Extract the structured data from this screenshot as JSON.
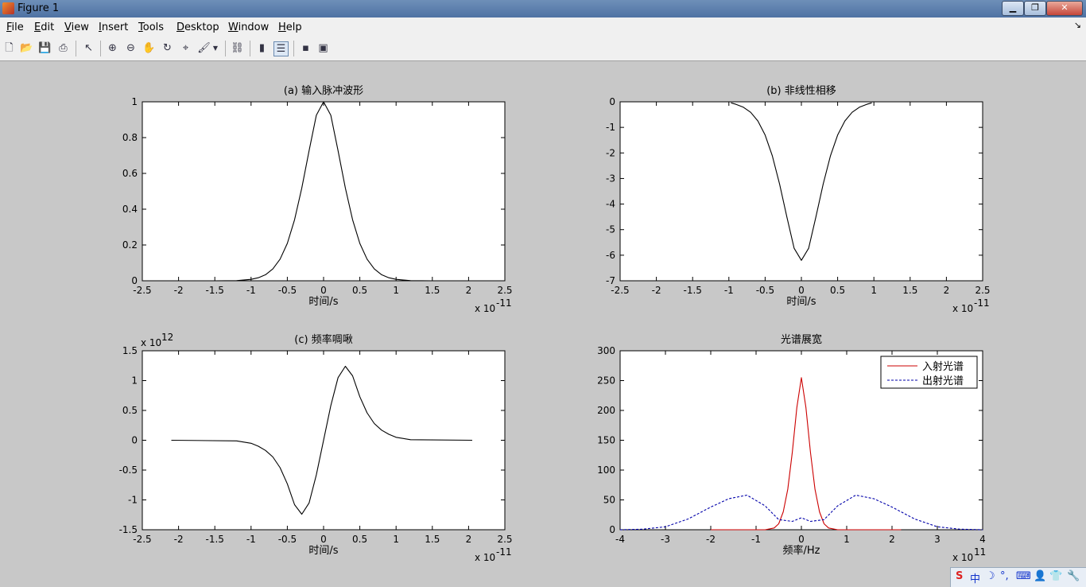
{
  "window": {
    "title": "Figure 1"
  },
  "menu": [
    {
      "label": "File",
      "key": "F",
      "rest": "ile"
    },
    {
      "label": "Edit",
      "key": "E",
      "rest": "dit"
    },
    {
      "label": "View",
      "key": "V",
      "rest": "iew"
    },
    {
      "label": "Insert",
      "key": "I",
      "rest": "nsert"
    },
    {
      "label": "Tools",
      "key": "T",
      "rest": "ools"
    },
    {
      "label": "Desktop",
      "key": "D",
      "rest": "esktop"
    },
    {
      "label": "Window",
      "key": "W",
      "rest": "indow"
    },
    {
      "label": "Help",
      "key": "H",
      "rest": "elp"
    }
  ],
  "toolbar_icons": [
    "new-figure-icon",
    "open-file-icon",
    "save-icon",
    "print-icon",
    "pointer-icon",
    "zoom-in-icon",
    "zoom-out-icon",
    "pan-hand-icon",
    "rotate-3d-icon",
    "data-cursor-icon",
    "brush-icon",
    "brush-dropdown-icon",
    "link-plot-icon",
    "colorbar-icon",
    "legend-icon",
    "hide-plot-tools-icon",
    "show-plot-tools-icon"
  ],
  "tray": {
    "ime_char": "中"
  },
  "colors": {
    "incident": "#cc0000",
    "output": "#0000aa",
    "curve": "#000000"
  },
  "chart_data": [
    {
      "type": "line",
      "title": "(a) 输入脉冲波形",
      "xlabel": "时间/s",
      "ylabel": "",
      "x_exponent": "x 10",
      "x_exponent_power": "-11",
      "xlim": [
        -2.5,
        2.5
      ],
      "ylim": [
        0,
        1
      ],
      "xticks": [
        "-2.5",
        "-2",
        "-1.5",
        "-1",
        "-0.5",
        "0",
        "0.5",
        "1",
        "1.5",
        "2",
        "2.5"
      ],
      "yticks": [
        "0",
        "0.2",
        "0.4",
        "0.6",
        "0.8",
        "1"
      ],
      "series": [
        {
          "color": "#000000",
          "style": "solid",
          "x": [
            -2.1,
            -1.5,
            -1.2,
            -1.0,
            -0.9,
            -0.8,
            -0.7,
            -0.6,
            -0.5,
            -0.4,
            -0.3,
            -0.2,
            -0.1,
            0,
            0.1,
            0.2,
            0.3,
            0.4,
            0.5,
            0.6,
            0.7,
            0.8,
            0.9,
            1.0,
            1.2,
            1.5,
            2.05
          ],
          "y": [
            0,
            0,
            0.001,
            0.008,
            0.017,
            0.034,
            0.066,
            0.121,
            0.209,
            0.341,
            0.518,
            0.727,
            0.925,
            1.0,
            0.925,
            0.727,
            0.518,
            0.341,
            0.209,
            0.121,
            0.066,
            0.034,
            0.017,
            0.008,
            0.001,
            0,
            0
          ]
        }
      ]
    },
    {
      "type": "line",
      "title": "(b) 非线性相移",
      "xlabel": "时间/s",
      "ylabel": "",
      "x_exponent": "x 10",
      "x_exponent_power": "-11",
      "xlim": [
        -2.5,
        2.5
      ],
      "ylim": [
        -7,
        0
      ],
      "xticks": [
        "-2.5",
        "-2",
        "-1.5",
        "-1",
        "-0.5",
        "0",
        "0.5",
        "1",
        "1.5",
        "2",
        "2.5"
      ],
      "yticks": [
        "-7",
        "-6",
        "-5",
        "-4",
        "-3",
        "-2",
        "-1",
        "0"
      ],
      "series": [
        {
          "color": "#000000",
          "style": "solid",
          "x": [
            -0.97,
            -0.9,
            -0.8,
            -0.7,
            -0.6,
            -0.5,
            -0.4,
            -0.3,
            -0.2,
            -0.1,
            0,
            0.1,
            0.2,
            0.3,
            0.4,
            0.5,
            0.6,
            0.7,
            0.8,
            0.9,
            0.97
          ],
          "y": [
            -0.04,
            -0.1,
            -0.21,
            -0.41,
            -0.75,
            -1.3,
            -2.12,
            -3.22,
            -4.51,
            -5.73,
            -6.2,
            -5.73,
            -4.51,
            -3.22,
            -2.12,
            -1.3,
            -0.75,
            -0.41,
            -0.21,
            -0.1,
            -0.04
          ]
        }
      ]
    },
    {
      "type": "line",
      "title": "(c) 频率啁啾",
      "xlabel": "时间/s",
      "ylabel": "",
      "x_exponent": "x 10",
      "x_exponent_power": "-11",
      "y_exponent": "x 10",
      "y_exponent_power": "12",
      "xlim": [
        -2.5,
        2.5
      ],
      "ylim": [
        -1.5,
        1.5
      ],
      "xticks": [
        "-2.5",
        "-2",
        "-1.5",
        "-1",
        "-0.5",
        "0",
        "0.5",
        "1",
        "1.5",
        "2",
        "2.5"
      ],
      "yticks": [
        "-1.5",
        "-1",
        "-0.5",
        "0",
        "0.5",
        "1",
        "1.5"
      ],
      "series": [
        {
          "color": "#000000",
          "style": "solid",
          "x": [
            -2.1,
            -1.2,
            -1.0,
            -0.9,
            -0.8,
            -0.7,
            -0.6,
            -0.5,
            -0.4,
            -0.3,
            -0.2,
            -0.1,
            0,
            0.1,
            0.2,
            0.3,
            0.4,
            0.5,
            0.6,
            0.7,
            0.8,
            0.9,
            1.0,
            1.2,
            2.05
          ],
          "y": [
            0,
            -0.01,
            -0.05,
            -0.1,
            -0.17,
            -0.28,
            -0.46,
            -0.73,
            -1.08,
            -1.24,
            -1.05,
            -0.58,
            0,
            0.58,
            1.05,
            1.24,
            1.08,
            0.73,
            0.46,
            0.28,
            0.17,
            0.1,
            0.05,
            0.01,
            0
          ]
        }
      ]
    },
    {
      "type": "line",
      "title": "光谱展宽",
      "xlabel": "频率/Hz",
      "ylabel": "",
      "x_exponent": "x 10",
      "x_exponent_power": "11",
      "xlim": [
        -4,
        4
      ],
      "ylim": [
        0,
        300
      ],
      "xticks": [
        "-4",
        "-3",
        "-2",
        "-1",
        "0",
        "1",
        "2",
        "3",
        "4"
      ],
      "yticks": [
        "0",
        "50",
        "100",
        "150",
        "200",
        "250",
        "300"
      ],
      "legend": {
        "position": "top-right",
        "entries": [
          "入射光谱",
          "出射光谱"
        ]
      },
      "series": [
        {
          "name": "入射光谱",
          "color": "#cc0000",
          "style": "solid",
          "x": [
            -2.0,
            -0.8,
            -0.6,
            -0.5,
            -0.4,
            -0.3,
            -0.2,
            -0.1,
            0,
            0.1,
            0.2,
            0.3,
            0.4,
            0.5,
            0.6,
            0.8,
            2.2
          ],
          "y": [
            0,
            0,
            3,
            10,
            30,
            68,
            130,
            205,
            255,
            205,
            130,
            68,
            30,
            10,
            3,
            0,
            0
          ]
        },
        {
          "name": "出射光谱",
          "color": "#0000aa",
          "style": "dashed",
          "x": [
            -4,
            -3.5,
            -3.0,
            -2.5,
            -2.0,
            -1.6,
            -1.2,
            -0.8,
            -0.5,
            -0.2,
            0,
            0.2,
            0.5,
            0.8,
            1.2,
            1.6,
            2.0,
            2.5,
            3.0,
            3.5,
            4
          ],
          "y": [
            0,
            1,
            5,
            18,
            38,
            52,
            58,
            40,
            17,
            14,
            20,
            14,
            17,
            40,
            58,
            52,
            38,
            18,
            5,
            1,
            0
          ]
        }
      ]
    }
  ]
}
